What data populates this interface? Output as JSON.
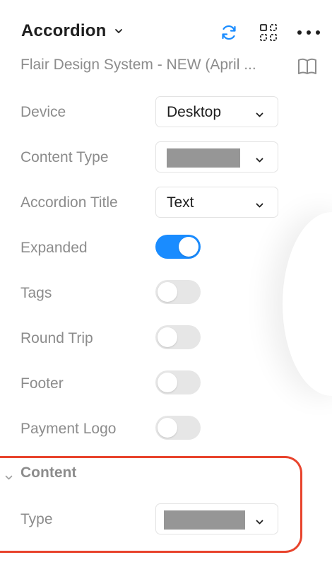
{
  "header": {
    "title": "Accordion",
    "icons": [
      "chevron-down-icon",
      "refresh-icon",
      "component-grid-icon",
      "more-options-icon"
    ]
  },
  "subtitle": "Flair Design System - NEW (April ...",
  "book_icon": "book-icon",
  "props": {
    "device": {
      "label": "Device",
      "value": "Desktop"
    },
    "content_type": {
      "label": "Content Type",
      "value": ""
    },
    "accordion_title": {
      "label": "Accordion Title",
      "value": "Text"
    },
    "expanded": {
      "label": "Expanded",
      "on": true
    },
    "tags": {
      "label": "Tags",
      "on": false
    },
    "round_trip": {
      "label": "Round Trip",
      "on": false
    },
    "footer": {
      "label": "Footer",
      "on": false
    },
    "payment_logo": {
      "label": "Payment Logo",
      "on": false
    }
  },
  "content_section": {
    "title": "Content",
    "type": {
      "label": "Type",
      "value": ""
    }
  },
  "colors": {
    "accent": "#1a8cff",
    "highlight": "#e8442d",
    "label": "#8c8c8c",
    "redacted": "#969696"
  }
}
